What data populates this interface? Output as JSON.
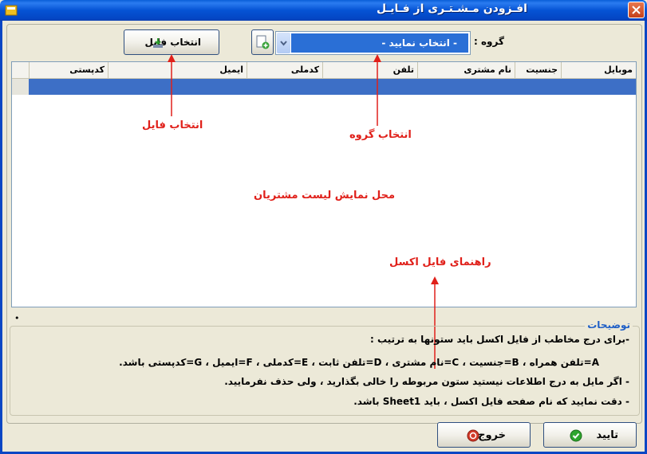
{
  "window": {
    "title": "افـزودن مـشـتـری از فـایـل"
  },
  "toolbar": {
    "file_button_label": "انتخاب فایل",
    "group_label": "گروه :",
    "group_select_value": "- انتخاب نمایید -"
  },
  "grid": {
    "columns": [
      "موبایل",
      "جنسیت",
      "نام مشتری",
      "تلفن",
      "کدملی",
      "ایمیل",
      "کدپستی"
    ]
  },
  "annotations": {
    "select_file": "انتخاب فایل",
    "select_group": "انتخاب گروه",
    "list_area": "محل نمایش لیست مشتریان",
    "excel_guide": "راهنمای فایل اکسل",
    "color": "#e0201a"
  },
  "description": {
    "legend": "توضیحات",
    "dot": "•",
    "lines": [
      "-برای درج مخاطب از فایل اکسل باید ستونها به ترتیب :",
      "A=تلفن همراه   ،   B=جنسیت   ،   C=نام مشتری   ،   D=تلفن ثابت   ،   E=کدملی   ،   F=ایمیل   ،   G=کدپستی   باشد.",
      "- اگر مایل به درج اطلاعات نیستید ستون مربوطه را خالی بگذارید ، ولی حذف نفرمایید.",
      "- دقت نمایید که نام صفحه فایل اکسل ، باید Sheet1 باشد."
    ]
  },
  "footer": {
    "ok_label": "تایید",
    "exit_label": "خروج"
  },
  "colors": {
    "accent": "#0a46c4",
    "selection": "#3d6fc6"
  }
}
